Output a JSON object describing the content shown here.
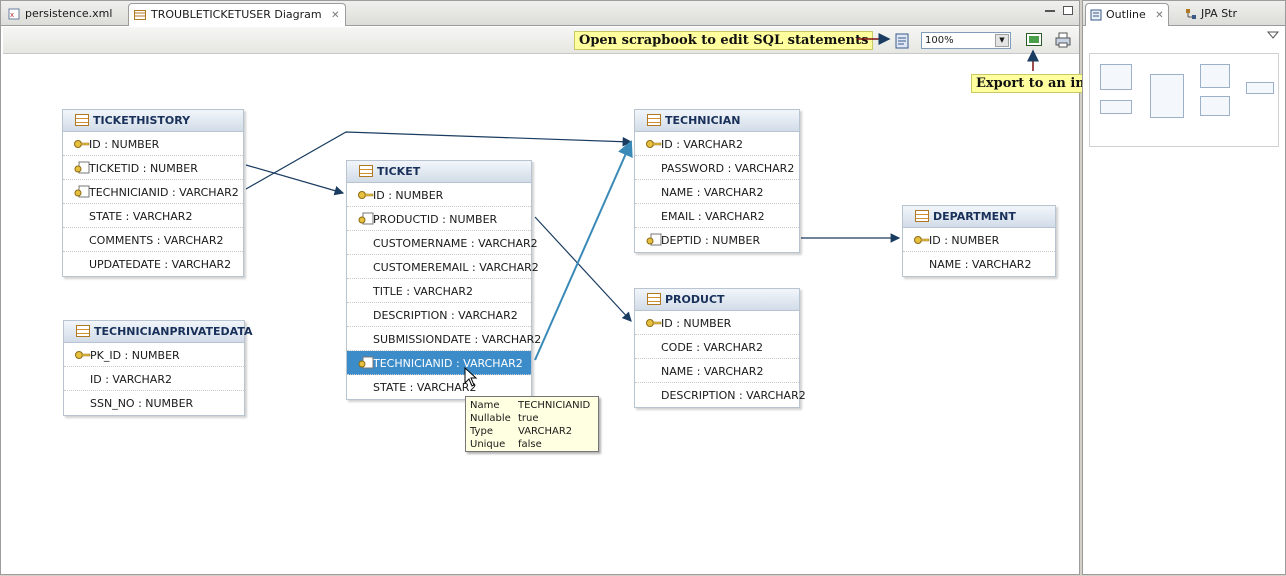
{
  "editor_tabs": [
    {
      "label": "persistence.xml",
      "active": false
    },
    {
      "label": "TROUBLETICKETUSER Diagram",
      "active": true
    }
  ],
  "toolbar": {
    "scrapbook_callout": "Open scrapbook to edit SQL statements",
    "zoom_value": "100%",
    "export_callout": "Export to an image"
  },
  "tables": {
    "tickethistory": {
      "name": "TICKETHISTORY",
      "columns": [
        "ID : NUMBER",
        "TICKETID : NUMBER",
        "TECHNICIANID : VARCHAR2",
        "STATE : VARCHAR2",
        "COMMENTS : VARCHAR2",
        "UPDATEDATE : VARCHAR2"
      ]
    },
    "technicianprivatedata": {
      "name": "TECHNICIANPRIVATEDATA",
      "columns": [
        "PK_ID : NUMBER",
        "ID : VARCHAR2",
        "SSN_NO : NUMBER"
      ]
    },
    "ticket": {
      "name": "TICKET",
      "columns": [
        "ID : NUMBER",
        "PRODUCTID : NUMBER",
        "CUSTOMERNAME : VARCHAR2",
        "CUSTOMEREMAIL : VARCHAR2",
        "TITLE : VARCHAR2",
        "DESCRIPTION : VARCHAR2",
        "SUBMISSIONDATE : VARCHAR2",
        "TECHNICIANID : VARCHAR2",
        "STATE : VARCHAR2"
      ]
    },
    "technician": {
      "name": "TECHNICIAN",
      "columns": [
        "ID : VARCHAR2",
        "PASSWORD : VARCHAR2",
        "NAME : VARCHAR2",
        "EMAIL : VARCHAR2",
        "DEPTID : NUMBER"
      ]
    },
    "product": {
      "name": "PRODUCT",
      "columns": [
        "ID : NUMBER",
        "CODE : VARCHAR2",
        "NAME : VARCHAR2",
        "DESCRIPTION : VARCHAR2"
      ]
    },
    "department": {
      "name": "DEPARTMENT",
      "columns": [
        "ID : NUMBER",
        "NAME : VARCHAR2"
      ]
    }
  },
  "tooltip": {
    "name_key": "Name",
    "name_val": "TECHNICIANID",
    "nullable_key": "Nullable",
    "nullable_val": "true",
    "type_key": "Type",
    "type_val": "VARCHAR2",
    "unique_key": "Unique",
    "unique_val": "false"
  },
  "side_tabs": [
    {
      "label": "Outline",
      "active": true
    },
    {
      "label": "JPA Str",
      "active": false
    }
  ],
  "colors": {
    "callout_bg": "#ffff9e",
    "selection": "#3c8cca",
    "link": "#1a3c60"
  }
}
